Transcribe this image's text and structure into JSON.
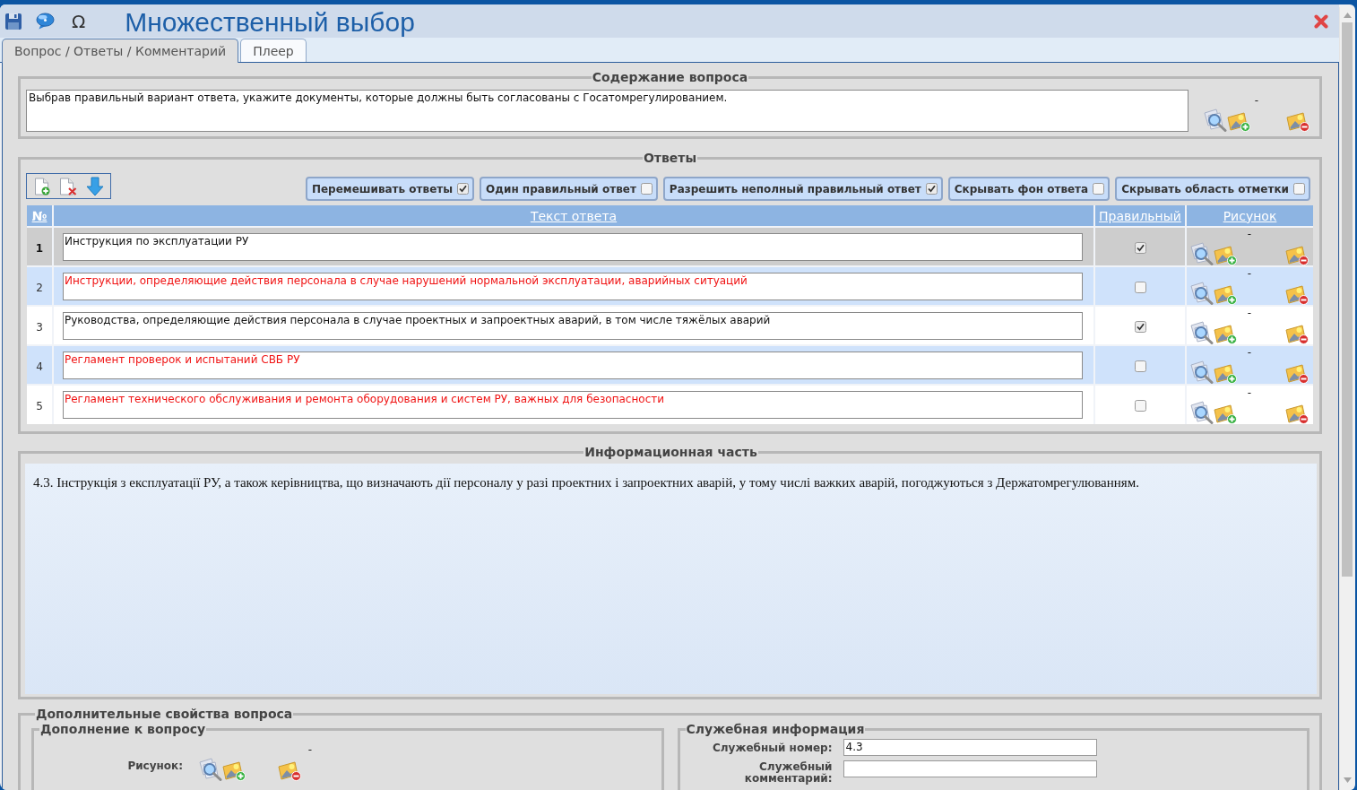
{
  "window": {
    "title": "Множественный выбор",
    "symbol_button": "Ω"
  },
  "tabs": [
    {
      "label": "Вопрос / Ответы / Комментарий",
      "selected": true
    },
    {
      "label": "Плеер",
      "selected": false
    }
  ],
  "question_content": {
    "legend": "Содержание вопроса",
    "value": "Выбрав правильный вариант ответа, укажите документы, которые должны быть согласованы с Госатомрегулированием.",
    "picture": "-"
  },
  "answers": {
    "legend": "Ответы",
    "options": [
      {
        "label": "Перемешивать ответы",
        "checked": true
      },
      {
        "label": "Один правильный ответ",
        "checked": false
      },
      {
        "label": "Разрешить неполный правильный ответ",
        "checked": true
      },
      {
        "label": "Скрывать фон ответа",
        "checked": false
      },
      {
        "label": "Скрывать область отметки",
        "checked": false
      }
    ],
    "columns": [
      "№",
      "Текст ответа",
      "Правильный",
      "Рисунок"
    ],
    "rows": [
      {
        "number": "1",
        "text": "Инструкция по эксплуатации РУ",
        "correct": true,
        "selected": true,
        "picture": "-"
      },
      {
        "number": "2",
        "text": "Инструкции, определяющие действия персонала в случае нарушений нормальной эксплуатации, аварийных ситуаций",
        "correct": false,
        "selected": false,
        "picture": "-"
      },
      {
        "number": "3",
        "text": "Руководства, определяющие действия персонала в случае проектных и запроектных аварий, в том числе тяжёлых аварий",
        "correct": true,
        "selected": false,
        "picture": "-"
      },
      {
        "number": "4",
        "text": "Регламент проверок и испытаний СВБ РУ",
        "correct": false,
        "selected": false,
        "picture": "-"
      },
      {
        "number": "5",
        "text": "Регламент технического обслуживания и ремонта оборудования и систем РУ, важных для безопасности",
        "correct": false,
        "selected": false,
        "picture": "-"
      }
    ]
  },
  "information": {
    "legend": "Информационная часть",
    "text": "4.3. Інструкція з експлуатації РУ, а також керівництва, що визначають дії персоналу у разі проектних і запроектних аварій, у тому числі важких аварій, погоджуються з Держатомрегулюванням."
  },
  "additional_properties": {
    "legend": "Дополнительные свойства вопроса",
    "question_addition": {
      "legend": "Дополнение к вопросу",
      "picture_label": "Рисунок:",
      "picture": "-"
    },
    "service_info": {
      "legend": "Служебная информация",
      "fields": [
        {
          "label": "Служебный номер:",
          "value": "4.3"
        },
        {
          "label": "Служебный комментарий:"
        }
      ]
    }
  }
}
